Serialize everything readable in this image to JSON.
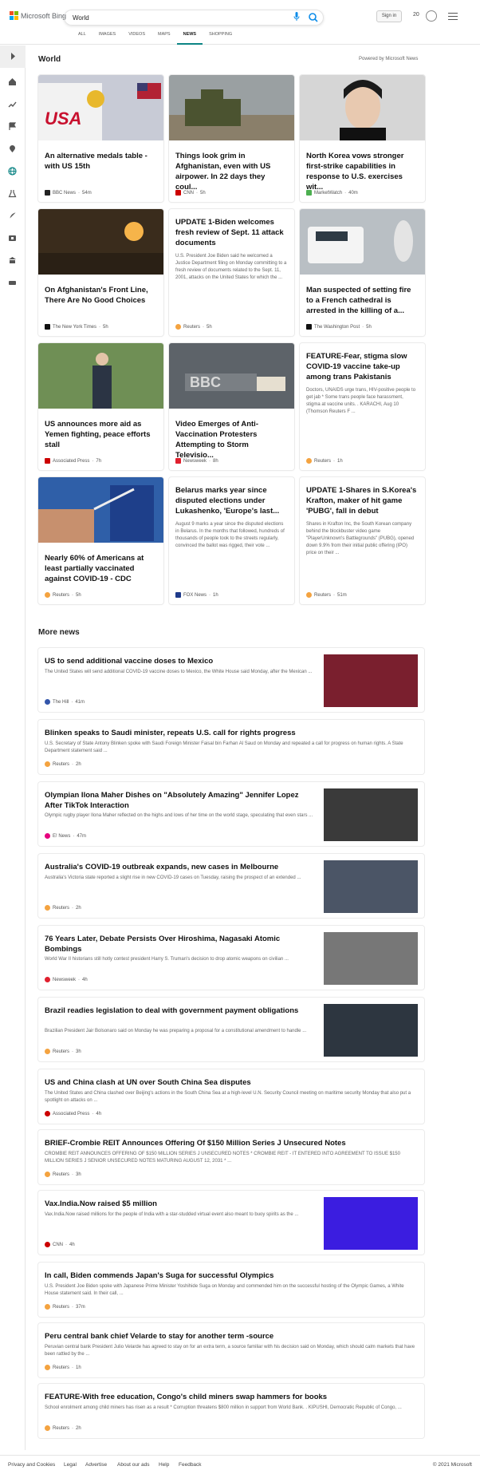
{
  "header": {
    "brand": "Microsoft Bing",
    "query": "World",
    "signin": "Sign in",
    "rewards": "20"
  },
  "tabs": [
    "ALL",
    "IMAGES",
    "VIDEOS",
    "MAPS",
    "NEWS",
    "SHOPPING"
  ],
  "section_title": "World",
  "powered": "Powered by Microsoft News",
  "cards": [
    {
      "title": "An alternative medals table - with US 15th",
      "summary": "",
      "source": "BBC News",
      "age": "54m",
      "color": "#222"
    },
    {
      "title": "Things look grim in Afghanistan, even with US airpower. In 22 days they coul...",
      "summary": "",
      "source": "CNN",
      "age": "5h",
      "color": "#cc0000"
    },
    {
      "title": "North Korea vows stronger first-strike capabilities in response to U.S. exercises wit...",
      "summary": "",
      "source": "MarketWatch",
      "age": "40m",
      "color": "#4caf50"
    },
    {
      "title": "On Afghanistan's Front Line, There Are No Good Choices",
      "summary": "",
      "source": "The New York Times",
      "age": "5h",
      "color": "#111"
    },
    {
      "title": "UPDATE 1-Biden welcomes fresh review of Sept. 11 attack documents",
      "summary": "U.S. President Joe Biden said he welcomed a Justice Department filing on Monday committing to a fresh review of documents related to the Sept. 11, 2001, attacks on the United States for which the ...",
      "source": "Reuters",
      "age": "5h",
      "color": "#f4a340"
    },
    {
      "title": "Man suspected of setting fire to a French cathedral is arrested in the killing of a...",
      "summary": "",
      "source": "The Washington Post",
      "age": "5h",
      "color": "#111"
    },
    {
      "title": "US announces more aid as Yemen fighting, peace efforts stall",
      "summary": "",
      "source": "Associated Press",
      "age": "7h",
      "color": "#c00"
    },
    {
      "title": "Video Emerges of Anti-Vaccination Protesters Attempting to Storm Televisio...",
      "summary": "",
      "source": "Newsweek",
      "age": "8h",
      "color": "#e0202e"
    },
    {
      "title": "FEATURE-Fear, stigma slow COVID-19 vaccine take-up among trans Pakistanis",
      "summary": "Doctors, UNAIDS urge trans, HIV-positive people to get jab * Some trans people face harassment, stigma at vaccine units. . KARACHI, Aug 10 (Thomson Reuters F ...",
      "source": "Reuters",
      "age": "1h",
      "color": "#f4a340"
    },
    {
      "title": "Nearly 60% of Americans at least partially vaccinated against COVID-19 - CDC",
      "summary": "",
      "source": "Reuters",
      "age": "5h",
      "color": "#f4a340"
    },
    {
      "title": "Belarus marks year since disputed elections under Lukashenko, 'Europe's last...",
      "summary": "August 9 marks a year since the disputed elections in Belarus. In the months that followed, hundreds of thousands of people took to the streets regularly, convinced the ballot was rigged, their vote ...",
      "source": "FOX News",
      "age": "1h",
      "color": "#1e3a8a"
    },
    {
      "title": "UPDATE 1-Shares in S.Korea's Krafton, maker of hit game 'PUBG', fall in debut",
      "summary": "Shares in Krafton Inc, the South Korean company behind the blockbuster video game \"PlayerUnknown's Battlegrounds\" (PUBG), opened down 9.9% from their initial public offering (IPO) price on their ...",
      "source": "Reuters",
      "age": "51m",
      "color": "#f4a340"
    }
  ],
  "more_title": "More news",
  "more": [
    {
      "title": "US to send additional vaccine doses to Mexico",
      "summary": "The United States will send additional COVID-19 vaccine doses to Mexico, the White House said Monday, after the Mexican ...",
      "source": "The Hill",
      "age": "41m",
      "color": "#3355aa",
      "thumb": "#7a1f2e"
    },
    {
      "title": "Blinken speaks to Saudi minister, repeats U.S. call for rights progress",
      "summary": "U.S. Secretary of State Antony Blinken spoke with Saudi Foreign Minister Faisal bin Farhan Al Saud on Monday and repeated a call for progress on human rights. A State Department statement said ...",
      "source": "Reuters",
      "age": "2h",
      "color": "#f4a340",
      "thumb": ""
    },
    {
      "title": "Olympian Ilona Maher Dishes on \"Absolutely Amazing\" Jennifer Lopez After TikTok Interaction",
      "summary": "Olympic rugby player Ilona Maher reflected on the highs and lows of her time on the world stage, speculating that even stars ...",
      "source": "E! News",
      "age": "47m",
      "color": "#e6007e",
      "thumb": "#3a3a3a"
    },
    {
      "title": "Australia's COVID-19 outbreak expands, new cases in Melbourne",
      "summary": "Australia's Victoria state reported a slight rise in new COVID-19 cases on Tuesday, raising the prospect of an extended ...",
      "source": "Reuters",
      "age": "2h",
      "color": "#f4a340",
      "thumb": "#4b5566"
    },
    {
      "title": "76 Years Later, Debate Persists Over Hiroshima, Nagasaki Atomic Bombings",
      "summary": "World War II historians still hotly contest president Harry S. Truman's decision to drop atomic weapons on civilian ...",
      "source": "Newsweek",
      "age": "4h",
      "color": "#e0202e",
      "thumb": "#777"
    },
    {
      "title": "Brazil readies legislation to deal with government payment obligations",
      "summary": "Brazilian President Jair Bolsonaro said on Monday he was preparing a proposal for a constitutional amendment to handle ...",
      "source": "Reuters",
      "age": "3h",
      "color": "#f4a340",
      "thumb": "#2d3640"
    },
    {
      "title": "US and China clash at UN over South China Sea disputes",
      "summary": "The United States and China clashed over Beijing's actions in the South China Sea at a high-level U.N. Security Council meeting on maritime security Monday that also put a spotlight on attacks on ...",
      "source": "Associated Press",
      "age": "4h",
      "color": "#c00",
      "thumb": ""
    },
    {
      "title": "BRIEF-Crombie REIT Announces Offering Of $150 Million Series J Unsecured Notes",
      "summary": "CROMBIE REIT ANNOUNCES OFFERING OF $150 MILLION SERIES J UNSECURED NOTES * CROMBIE REIT - IT ENTERED INTO AGREEMENT TO ISSUE $150 MILLION SERIES J SENIOR UNSECURED NOTES MATURING AUGUST 12, 2031 * ...",
      "source": "Reuters",
      "age": "3h",
      "color": "#f4a340",
      "thumb": ""
    },
    {
      "title": "Vax.India.Now raised $5 million",
      "summary": "Vax.India.Now raised millions for the people of India with a star-studded virtual event also meant to buoy spirits as the ...",
      "source": "CNN",
      "age": "4h",
      "color": "#cc0000",
      "thumb": "#3b1de0"
    },
    {
      "title": "In call, Biden commends Japan's Suga for successful Olympics",
      "summary": "U.S. President Joe Biden spoke with Japanese Prime Minister Yoshihide Suga on Monday and commended him on the successful hosting of the Olympic Games, a White House statement said. In their call, ...",
      "source": "Reuters",
      "age": "37m",
      "color": "#f4a340",
      "thumb": ""
    },
    {
      "title": "Peru central bank chief Velarde to stay for another term -source",
      "summary": "Peruvian central bank President Julio Velarde has agreed to stay on for an extra term, a source familiar with his decision said on Monday, which should calm markets that have been rattled by the ...",
      "source": "Reuters",
      "age": "1h",
      "color": "#f4a340",
      "thumb": ""
    },
    {
      "title": "FEATURE-With free education, Congo's child miners swap hammers for books",
      "summary": "School enrolment among child miners has risen as a result * Corruption threatens $800 million in support from World Bank. . KIPUSHI, Democratic Republic of Congo, ...",
      "source": "Reuters",
      "age": "2h",
      "color": "#f4a340",
      "thumb": ""
    }
  ],
  "footer": {
    "privacy": "Privacy and Cookies",
    "legal": "Legal",
    "advertise": "Advertise",
    "about": "About our ads",
    "help": "Help",
    "feedback": "Feedback",
    "copyright": "© 2021 Microsoft"
  }
}
